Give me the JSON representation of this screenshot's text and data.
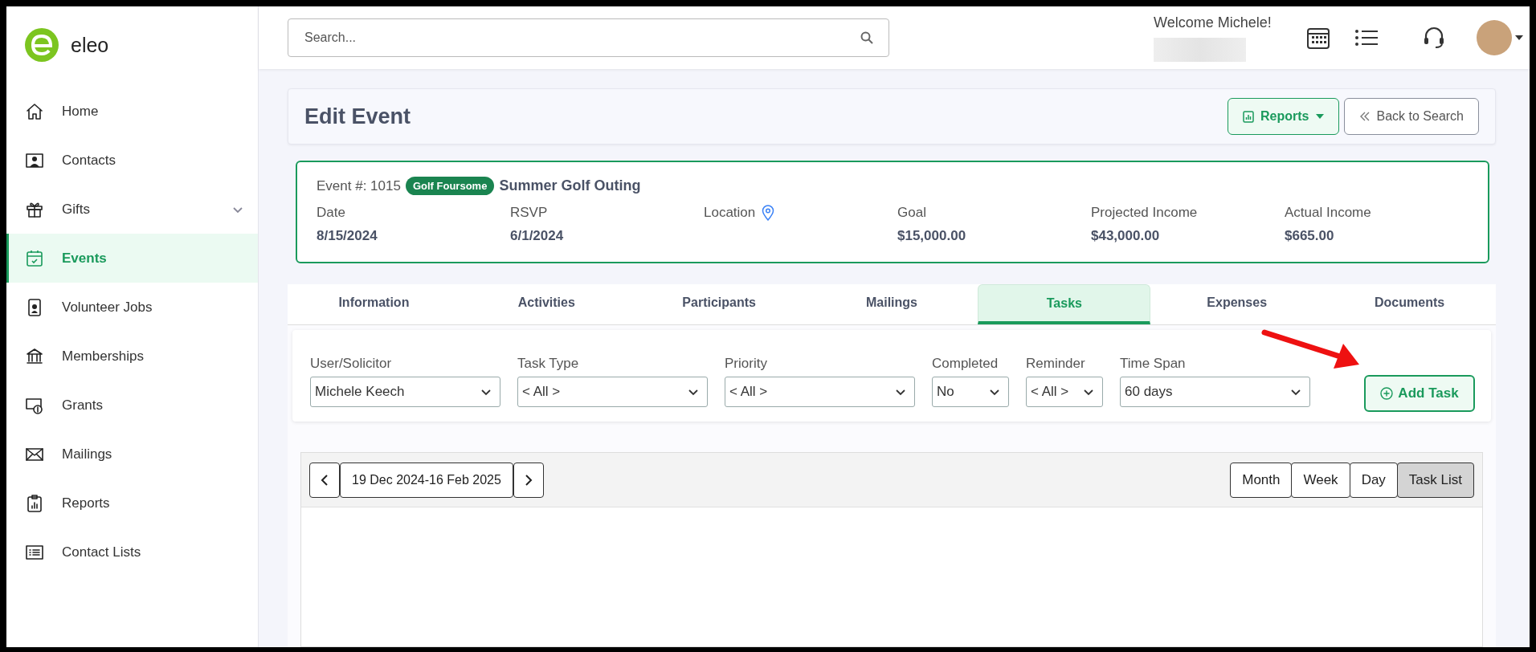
{
  "logo": {
    "text": "eleo"
  },
  "sidebar": {
    "items": [
      {
        "label": "Home",
        "kind": "link",
        "selected": false
      },
      {
        "label": "Contacts",
        "kind": "link",
        "selected": false
      },
      {
        "label": "Gifts",
        "kind": "group",
        "selected": false
      },
      {
        "label": "Events",
        "kind": "link",
        "selected": true
      },
      {
        "label": "Volunteer Jobs",
        "kind": "link",
        "selected": false
      },
      {
        "label": "Memberships",
        "kind": "link",
        "selected": false
      },
      {
        "label": "Grants",
        "kind": "link",
        "selected": false
      },
      {
        "label": "Mailings",
        "kind": "link",
        "selected": false
      },
      {
        "label": "Reports",
        "kind": "link",
        "selected": false
      },
      {
        "label": "Contact Lists",
        "kind": "link",
        "selected": false
      }
    ]
  },
  "topbar": {
    "search": {
      "placeholder": "Search..."
    },
    "welcome": "Welcome Michele!"
  },
  "page": {
    "title": "Edit Event",
    "buttons": [
      {
        "label": "Reports",
        "kind": "dropdown"
      },
      {
        "label": "Back to Search",
        "kind": "back"
      }
    ]
  },
  "event": {
    "number": "Event #: 1015",
    "tag": "Golf Foursome",
    "name": "Summer Golf Outing",
    "fields": [
      {
        "label": "Date",
        "value": "8/15/2024",
        "kind": "text"
      },
      {
        "label": "RSVP",
        "value": "6/1/2024",
        "kind": "text"
      },
      {
        "label": "Location",
        "kind": "location"
      },
      {
        "label": "Goal",
        "value": "$15,000.00",
        "kind": "text"
      },
      {
        "label": "Projected Income",
        "value": "$43,000.00",
        "kind": "text"
      },
      {
        "label": "Actual Income",
        "value": "$665.00",
        "kind": "text"
      }
    ]
  },
  "tabs": [
    {
      "label": "Information",
      "selected": false
    },
    {
      "label": "Activities",
      "selected": false
    },
    {
      "label": "Participants",
      "selected": false
    },
    {
      "label": "Mailings",
      "selected": false
    },
    {
      "label": "Tasks",
      "selected": true
    },
    {
      "label": "Expenses",
      "selected": false
    },
    {
      "label": "Documents",
      "selected": false
    }
  ],
  "filters": [
    {
      "label": "User/Solicitor",
      "value": "Michele Keech",
      "kind": "wide"
    },
    {
      "label": "Task Type",
      "value": "< All >",
      "kind": "wide"
    },
    {
      "label": "Priority",
      "value": "< All >",
      "kind": "wide"
    },
    {
      "label": "Completed",
      "value": "No",
      "kind": "narrow"
    },
    {
      "label": "Reminder",
      "value": "< All >",
      "kind": "narrow"
    },
    {
      "label": "Time Span",
      "value": "60 days",
      "kind": "wide"
    }
  ],
  "add_button": {
    "label": "Add Task"
  },
  "calendar": {
    "range": "19 Dec 2024-16 Feb 2025",
    "views": [
      {
        "label": "Month",
        "selected": false
      },
      {
        "label": "Week",
        "selected": false
      },
      {
        "label": "Day",
        "selected": false
      },
      {
        "label": "Task List",
        "selected": true
      }
    ]
  }
}
